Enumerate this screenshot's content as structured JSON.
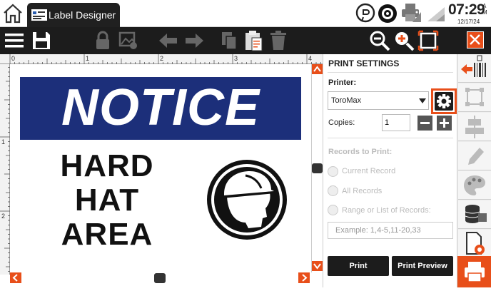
{
  "app": {
    "tab_label": "Label Designer"
  },
  "status": {
    "time": "07:29",
    "am": "A",
    "pm": "M",
    "date": "12/17/24"
  },
  "toolbar": {
    "items": [
      "menu-icon",
      "save-icon",
      "lock-icon",
      "image-icon",
      "undo-icon",
      "redo-icon",
      "copy-icon",
      "paste-icon",
      "delete-icon",
      "zoom-out-icon",
      "zoom-in-icon",
      "fit-icon",
      "close-icon"
    ]
  },
  "label": {
    "notice": "NOTICE",
    "line1": "HARD",
    "line2": "HAT",
    "line3": "AREA"
  },
  "ruler": {
    "marks": [
      "0",
      "1",
      "2",
      "3",
      "4"
    ]
  },
  "print_settings": {
    "title": "PRINT SETTINGS",
    "printer_label": "Printer:",
    "printer_value": "ToroMax",
    "copies_label": "Copies:",
    "copies_value": "1",
    "records_label": "Records to Print:",
    "opt_current": "Current Record",
    "opt_all": "All Records",
    "opt_range": "Range or List of Records:",
    "range_placeholder": "Example:  1,4-5,11-20,33",
    "print_button": "Print",
    "preview_button": "Print Preview"
  },
  "colors": {
    "accent": "#e84f1a",
    "banner": "#1c2f7a",
    "toolbar": "#1c1c1c"
  }
}
